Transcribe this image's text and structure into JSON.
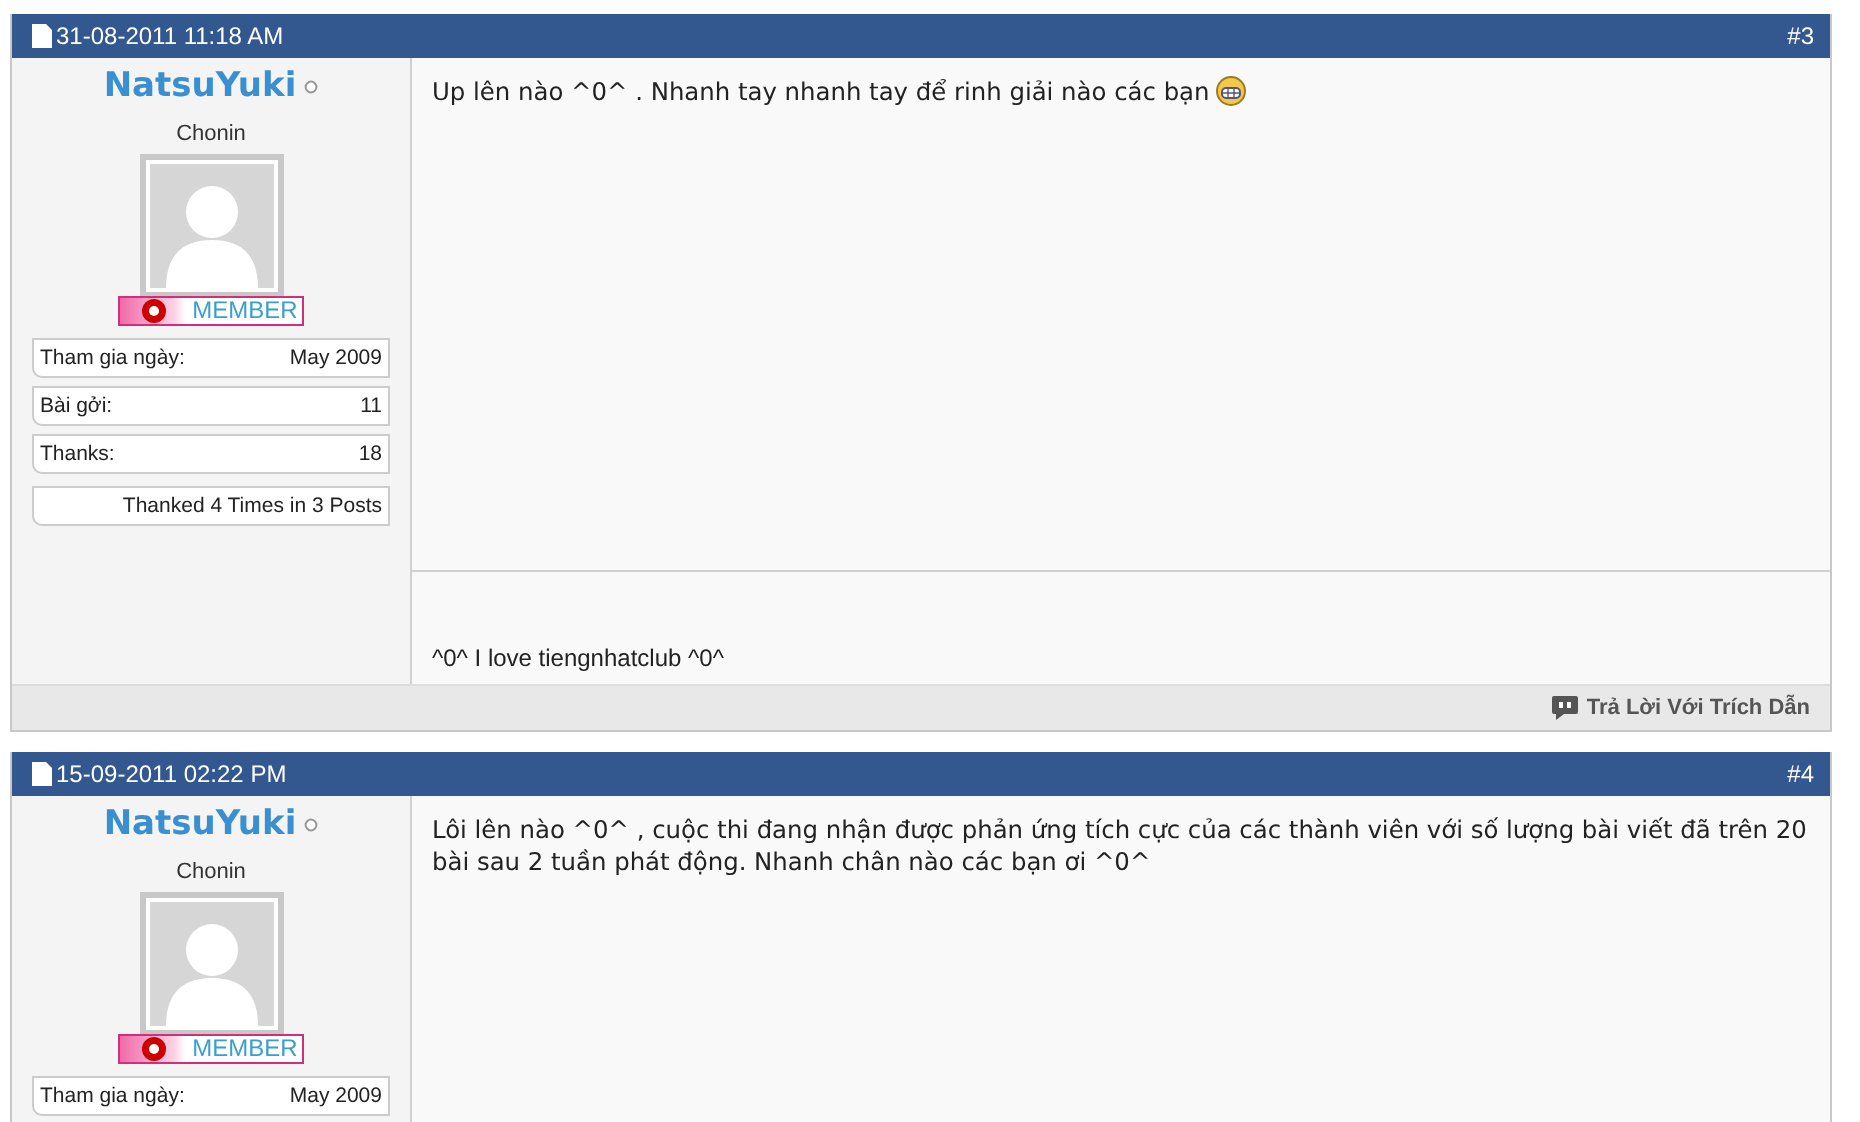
{
  "posts": [
    {
      "date": "31-08-2011 11:18 AM",
      "number": "#3",
      "user": {
        "name": "NatsuYuki",
        "online": false,
        "title": "Chonin",
        "rank": "MEMBER",
        "stats": [
          {
            "label": "Tham gia ngày:",
            "value": "May 2009"
          },
          {
            "label": "Bài gởi:",
            "value": "11"
          },
          {
            "label": "Thanks:",
            "value": "18"
          }
        ],
        "thanks_summary": "Thanked 4 Times in 3 Posts"
      },
      "message": "Up lên nào ^0^ . Nhanh tay nhanh tay để rinh giải nào các bạn",
      "smiley": true,
      "signature": "^0^ I love tiengnhatclub ^0^",
      "actions": [
        "Trả Lời Với Trích Dẫn"
      ]
    },
    {
      "date": "15-09-2011 02:22 PM",
      "number": "#4",
      "user": {
        "name": "NatsuYuki",
        "online": false,
        "title": "Chonin",
        "rank": "MEMBER",
        "stats": [
          {
            "label": "Tham gia ngày:",
            "value": "May 2009"
          }
        ]
      },
      "message": "Lôi lên nào ^0^ , cuộc thi đang nhận được phản ứng tích cực của các thành viên với số lượng bài viết đã trên 20 bài sau 2 tuần phát động. Nhanh chân nào các bạn ơi ^0^",
      "smiley": false
    }
  ]
}
